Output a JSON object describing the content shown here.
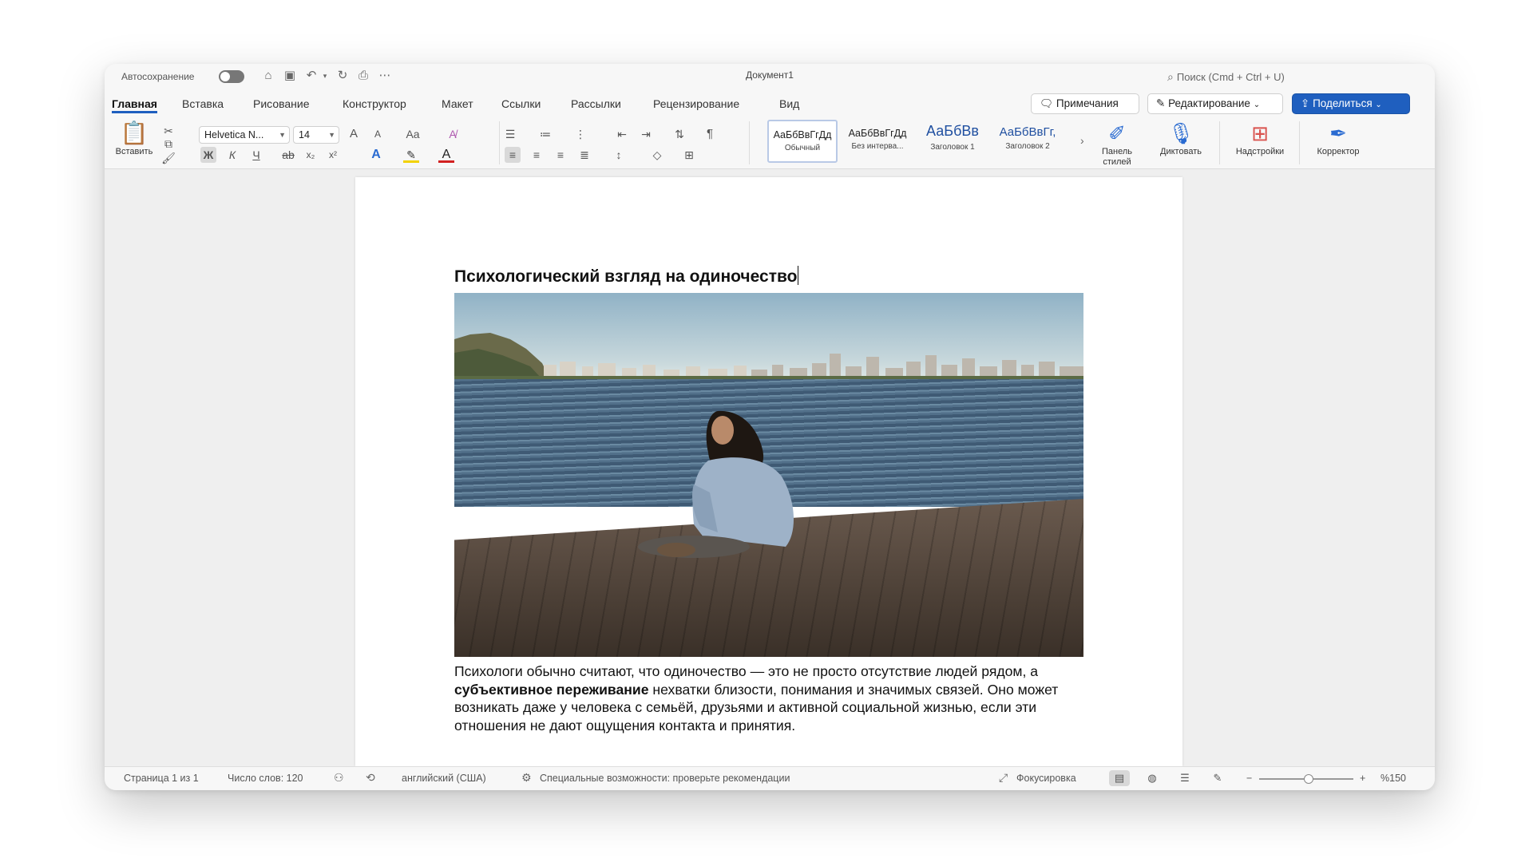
{
  "titlebar": {
    "autosave_label": "Автосохранение",
    "document_title": "Документ1",
    "search_label": "Поиск (Cmd + Ctrl + U)",
    "icons": [
      "home-icon",
      "save-icon",
      "undo-icon",
      "redo-icon",
      "print-icon",
      "more-icon"
    ]
  },
  "tabs": [
    "Главная",
    "Вставка",
    "Рисование",
    "Конструктор",
    "Макет",
    "Ссылки",
    "Рассылки",
    "Рецензирование",
    "Вид"
  ],
  "active_tab": "Главная",
  "actions": {
    "comments": "Примечания",
    "editing": "Редактирование",
    "share": "Поделиться"
  },
  "ribbon": {
    "paste": "Вставить",
    "font_name": "Helvetica N...",
    "font_size": "14",
    "grow_font": "A",
    "shrink_font": "A",
    "change_case": "Aa",
    "bold": "Ж",
    "italic": "К",
    "underline": "Ч",
    "strike": "ab",
    "subscript": "x₂",
    "superscript": "x²",
    "font_color_glyph": "A",
    "text_effects_glyph": "A",
    "pilcrow": "¶",
    "styles": [
      {
        "sample": "АаБбВвГгДд",
        "name": "Обычный"
      },
      {
        "sample": "АаБбВвГгДд",
        "name": "Без интерва..."
      },
      {
        "sample": "АаБбВв",
        "name": "Заголовок 1"
      },
      {
        "sample": "АаБбВвГг,",
        "name": "Заголовок 2"
      }
    ],
    "styles_pane": "Панель стилей",
    "dictate": "Диктовать",
    "addins": "Надстройки",
    "editor": "Корректор"
  },
  "document": {
    "heading": "Психологический взгляд на одиночество",
    "paragraph_parts": [
      "Психологи обычно считают, что одиночество — это не просто отсутствие людей рядом, а ",
      "субъективное переживание",
      " нехватки близости, понимания и значимых связей. Оно может возникать даже у человека с семьёй, друзьями и активной социальной жизнью, если эти отношения не дают ощущения контакта и принятия."
    ]
  },
  "statusbar": {
    "page": "Страница 1 из 1",
    "words": "Число слов: 120",
    "language": "английский (США)",
    "accessibility": "Специальные возможности: проверьте рекомендации",
    "focus": "Фокусировка",
    "zoom_minus": "−",
    "zoom_plus": "+",
    "zoom_value": "%150",
    "zoom_fraction": 0.5
  },
  "colors": {
    "accent": "#1f5fbf",
    "heading_style": "#1f4fa0",
    "highlight": "#f2d200",
    "font_color": "#d22020"
  }
}
